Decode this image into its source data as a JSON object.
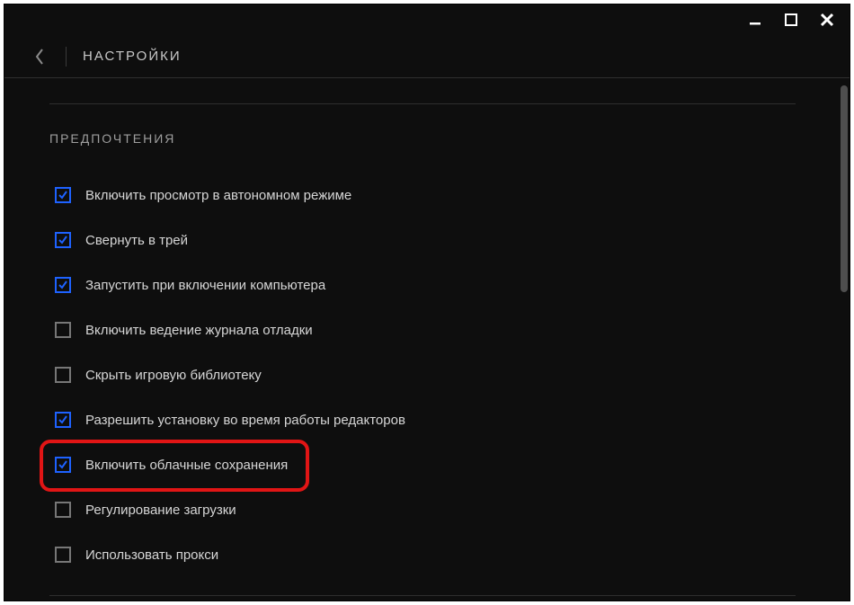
{
  "window": {
    "page_title": "НАСТРОЙКИ"
  },
  "section": {
    "title": "ПРЕДПОЧТЕНИЯ"
  },
  "options": [
    {
      "label": "Включить просмотр в автономном режиме",
      "checked": true,
      "highlighted": false
    },
    {
      "label": "Свернуть в трей",
      "checked": true,
      "highlighted": false
    },
    {
      "label": "Запустить при включении компьютера",
      "checked": true,
      "highlighted": false
    },
    {
      "label": "Включить ведение журнала отладки",
      "checked": false,
      "highlighted": false
    },
    {
      "label": "Скрыть игровую библиотеку",
      "checked": false,
      "highlighted": false
    },
    {
      "label": "Разрешить установку во время работы редакторов",
      "checked": true,
      "highlighted": false
    },
    {
      "label": "Включить облачные сохранения",
      "checked": true,
      "highlighted": true
    },
    {
      "label": "Регулирование загрузки",
      "checked": false,
      "highlighted": false
    },
    {
      "label": "Использовать прокси",
      "checked": false,
      "highlighted": false
    }
  ]
}
